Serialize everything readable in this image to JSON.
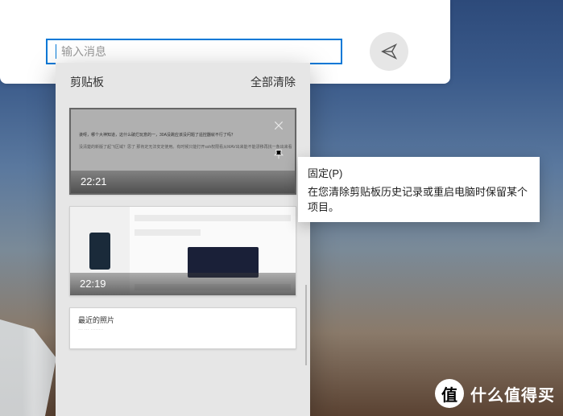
{
  "message_input": {
    "placeholder": "输入消息"
  },
  "clipboard": {
    "title": "剪贴板",
    "clear_all": "全部清除",
    "items": [
      {
        "time": "22:21",
        "selected": true,
        "line1": "诶呀，哪个大神知道，这什么破烂玩意的一，30A没跳应该没问题了遥控器就不行了吗？",
        "line2": "没清楚的新版了起飞区域？思了 那肯定无法安定使用。有时候只能打开ssh权限看从MAV出来能不能漂移再找一条出来看"
      },
      {
        "time": "22:19",
        "selected": false
      },
      {
        "time": "",
        "selected": false,
        "title": "最近的照片"
      }
    ]
  },
  "tooltip": {
    "title": "固定(P)",
    "desc": "在您清除剪贴板历史记录或重启电脑时保留某个项目。"
  },
  "watermark": {
    "badge": "值",
    "text": "什么值得买"
  }
}
